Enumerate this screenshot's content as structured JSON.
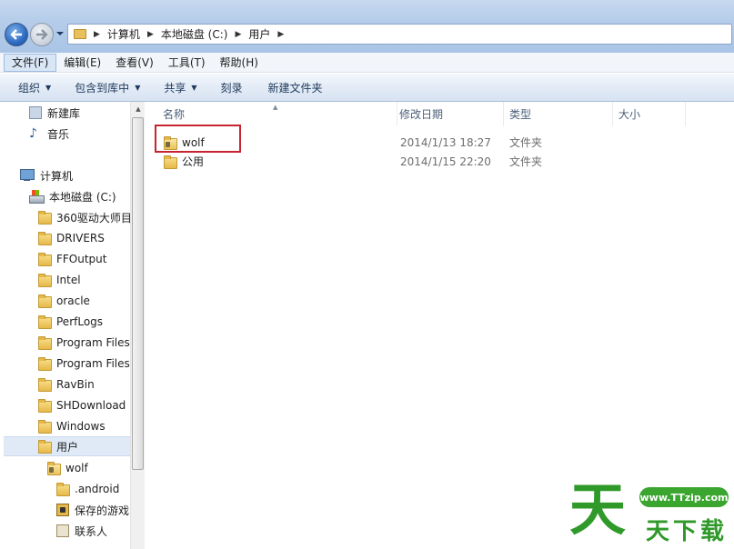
{
  "address_bar": {
    "crumbs": [
      "计算机",
      "本地磁盘 (C:)",
      "用户"
    ]
  },
  "menu": {
    "items": [
      "文件(F)",
      "编辑(E)",
      "查看(V)",
      "工具(T)",
      "帮助(H)"
    ],
    "active_index": 0
  },
  "toolbar": {
    "organize": "组织",
    "include_in_library": "包含到库中",
    "share": "共享",
    "burn": "刻录",
    "new_folder": "新建文件夹"
  },
  "nav_pane": {
    "new_library": "新建库",
    "music": "音乐",
    "computer": "计算机",
    "local_disk": "本地磁盘 (C:)",
    "folders": [
      "360驱动大师目",
      "DRIVERS",
      "FFOutput",
      "Intel",
      "oracle",
      "PerfLogs",
      "Program Files",
      "Program Files",
      "RavBin",
      "SHDownload",
      "Windows"
    ],
    "users": "用户",
    "wolf": "wolf",
    "wolf_children": [
      ".android",
      "保存的游戏",
      "联系人"
    ]
  },
  "file_list": {
    "columns": [
      "名称",
      "修改日期",
      "类型",
      "大小"
    ],
    "rows": [
      {
        "name": "wolf",
        "modified": "2014/1/13 18:27",
        "type": "文件夹"
      },
      {
        "name": "公用",
        "modified": "2014/1/15 22:20",
        "type": "文件夹"
      }
    ]
  },
  "watermark": {
    "url": "www.TTzip.com",
    "big_char": "天",
    "small_text": "天下载"
  },
  "colors": {
    "highlight_box": "#c6242e",
    "watermark_green": "#2f9a2a"
  }
}
